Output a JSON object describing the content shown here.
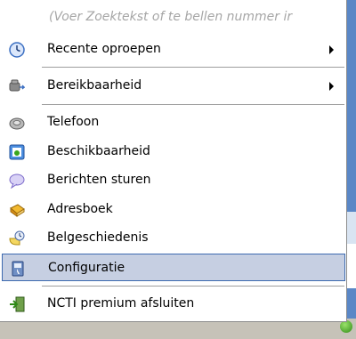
{
  "search": {
    "placeholder": "(Voer Zoektekst of te bellen nummer ir"
  },
  "menu": {
    "items": [
      {
        "label": "Recente oproepen",
        "icon": "clock-icon",
        "submenu": true
      },
      {
        "label": "Bereikbaarheid",
        "icon": "phone-forward-icon",
        "submenu": true
      },
      {
        "label": "Telefoon",
        "icon": "telephone-icon"
      },
      {
        "label": "Beschikbaarheid",
        "icon": "availability-icon"
      },
      {
        "label": "Berichten sturen",
        "icon": "speech-bubble-icon"
      },
      {
        "label": "Adresboek",
        "icon": "address-book-icon"
      },
      {
        "label": "Belgeschiedenis",
        "icon": "call-history-icon"
      },
      {
        "label": "Configuratie",
        "icon": "configuration-icon",
        "selected": true
      },
      {
        "label": "NCTI premium afsluiten",
        "icon": "exit-icon"
      }
    ]
  },
  "colors": {
    "selection_bg": "#c6cfe2",
    "selection_border": "#3d6ab0",
    "placeholder": "#a6a6a6"
  }
}
